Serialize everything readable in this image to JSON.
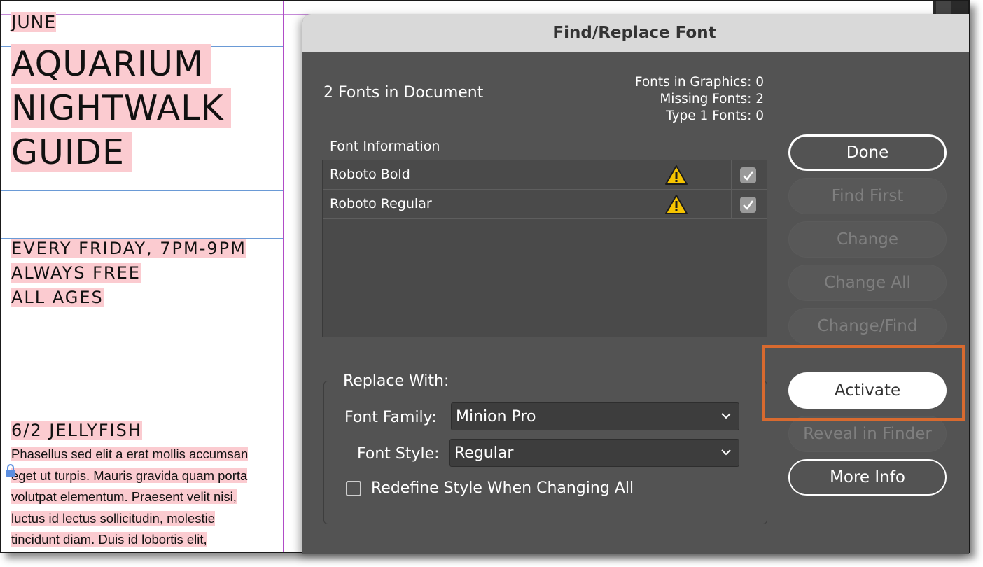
{
  "document": {
    "month": "JUNE",
    "title_lines": [
      "AQUARIUM",
      "NIGHTWALK",
      "GUIDE"
    ],
    "info_lines": [
      "EVERY FRIDAY, 7PM-9PM",
      "ALWAYS FREE",
      "ALL AGES"
    ],
    "event_heading": "6/2 JELLYFISH",
    "body_lines": [
      "Phasellus sed elit a erat mollis accumsan",
      "eget ut turpis. Mauris gravida quam porta",
      "volutpat elementum. Praesent velit nisi,",
      "luctus id lectus sollicitudin, molestie",
      "tincidunt diam. Duis id lobortis elit,"
    ],
    "highlight_color": "#fbcbd0"
  },
  "dialog": {
    "title": "Find/Replace Font",
    "fonts_count_label": "2 Fonts in Document",
    "stats": {
      "graphics": "Fonts in Graphics: 0",
      "missing": "Missing Fonts: 2",
      "type1": "Type 1 Fonts: 0"
    },
    "list_header": "Font Information",
    "fonts": [
      {
        "name": "Roboto Bold",
        "warning_icon": "warning-triangle-icon",
        "checked": true
      },
      {
        "name": "Roboto Regular",
        "warning_icon": "warning-triangle-icon",
        "checked": true
      }
    ],
    "buttons": {
      "done": "Done",
      "find_first": "Find First",
      "change": "Change",
      "change_all": "Change All",
      "change_find": "Change/Find",
      "activate": "Activate",
      "reveal": "Reveal in Finder",
      "more_info": "More Info"
    },
    "replace": {
      "legend": "Replace With:",
      "family_label": "Font Family:",
      "family_value": "Minion Pro",
      "style_label": "Font Style:",
      "style_value": "Regular",
      "redefine_label": "Redefine Style When Changing All",
      "redefine_checked": false
    },
    "accent_color": "#d86a2f"
  }
}
